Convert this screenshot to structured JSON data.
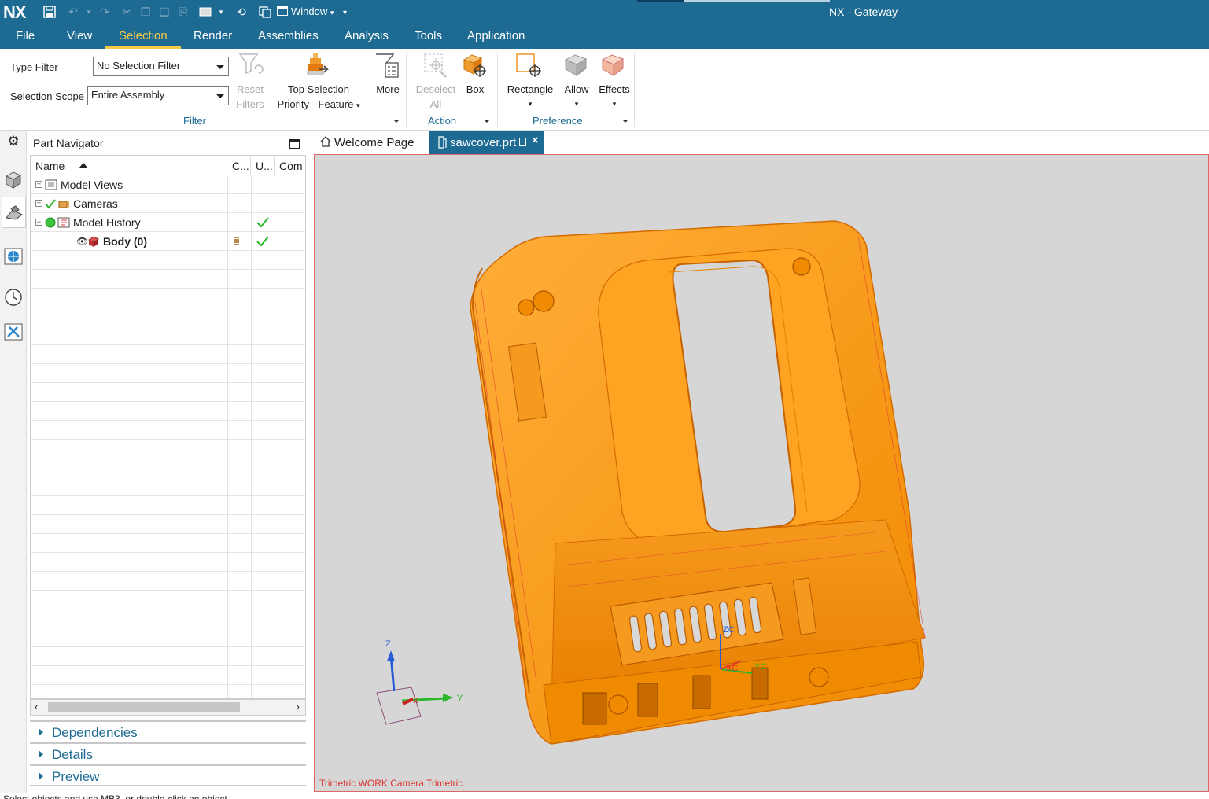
{
  "app": {
    "logo": "NX",
    "title": "NX - Gateway",
    "window_menu": "Window"
  },
  "menu": [
    "File",
    "View",
    "Selection",
    "Render",
    "Assemblies",
    "Analysis",
    "Tools",
    "Application"
  ],
  "active_menu": "Selection",
  "ribbon": {
    "type_filter_label": "Type Filter",
    "type_filter_value": "No Selection Filter",
    "scope_label": "Selection Scope",
    "scope_value": "Entire Assembly",
    "reset_filters": [
      "Reset",
      "Filters"
    ],
    "top_selection": [
      "Top Selection",
      "Priority - Feature"
    ],
    "more": "More",
    "filter_group": "Filter",
    "deselect_all": [
      "Deselect",
      "All"
    ],
    "box": "Box",
    "action_group": "Action",
    "rectangle": "Rectangle",
    "allow": "Allow",
    "effects": "Effects",
    "preference_group": "Preference"
  },
  "navigator": {
    "title": "Part Navigator",
    "columns": [
      "Name",
      "C...",
      "U...",
      "Com"
    ],
    "rows": [
      {
        "name": "Model Views",
        "expander": "+",
        "bold": false
      },
      {
        "name": "Cameras",
        "expander": "+",
        "bold": false,
        "check": true
      },
      {
        "name": "Model History",
        "expander": "−",
        "bold": false,
        "up_to_date": true
      },
      {
        "name": "Body (0)",
        "expander": "",
        "bold": true,
        "up_to_date": true
      }
    ],
    "panels": [
      "Dependencies",
      "Details",
      "Preview"
    ]
  },
  "tabs": [
    {
      "label": "Welcome Page",
      "active": false
    },
    {
      "label": "sawcover.prt",
      "active": true
    }
  ],
  "viewport": {
    "caption": "Trimetric WORK Camera Trimetric",
    "triad": {
      "x": "X",
      "y": "Y",
      "z": "Z"
    },
    "wcs": {
      "xc": "XC",
      "yc": "YC",
      "zc": "ZC"
    },
    "part_color": "#ff9a1c"
  },
  "status": "Select objects and use MB3, or double-click an object"
}
